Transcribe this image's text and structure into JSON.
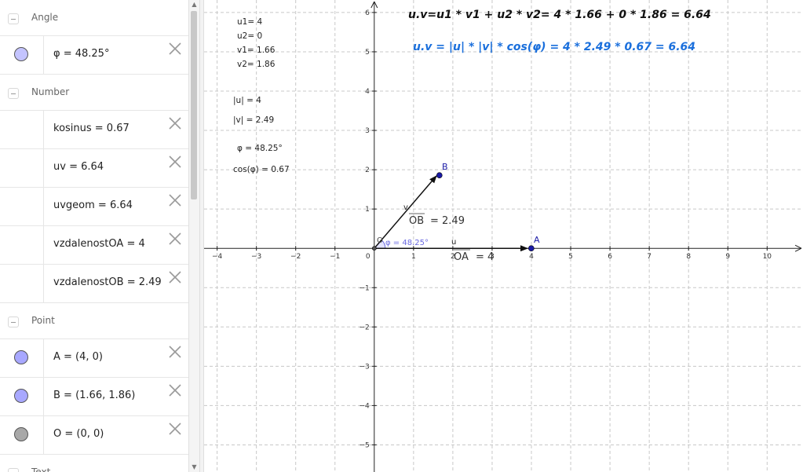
{
  "algebra": {
    "groups": [
      {
        "label": "Angle",
        "items": [
          {
            "text": "φ = 48.25°",
            "marker": "#c4c4ff"
          }
        ]
      },
      {
        "label": "Number",
        "items": [
          {
            "text": "kosinus = 0.67",
            "marker": ""
          },
          {
            "text": "uv = 6.64",
            "marker": ""
          },
          {
            "text": "uvgeom = 6.64",
            "marker": ""
          },
          {
            "text": "vzdalenostOA = 4",
            "marker": ""
          },
          {
            "text": "vzdalenostOB = 2.49",
            "marker": ""
          }
        ]
      },
      {
        "label": "Point",
        "items": [
          {
            "text": "A = (4, 0)",
            "marker": "#a8a8ff"
          },
          {
            "text": "B = (1.66, 1.86)",
            "marker": "#a8a8ff"
          },
          {
            "text": "O = (0, 0)",
            "marker": "#a8a8a8"
          }
        ]
      },
      {
        "label": "Text",
        "items": []
      }
    ]
  },
  "graphics": {
    "x_ticks": [
      "−4",
      "−3",
      "−2",
      "−1",
      "0",
      "1",
      "2",
      "3",
      "4",
      "5",
      "6",
      "7",
      "8",
      "9",
      "10"
    ],
    "y_ticks": [
      "6",
      "5",
      "4",
      "3",
      "2",
      "1",
      "−1",
      "−2",
      "−3",
      "−4",
      "−5"
    ],
    "texts": {
      "u1": "u1= 4",
      "u2": "u2= 0",
      "v1": "v1= 1.66",
      "v2": "v2= 1.86",
      "abs_u": "|u| = 4",
      "abs_v": "|v| = 2.49",
      "phi": "φ = 48.25°",
      "cos": "cos(φ) = 0.67",
      "formula1": "u.v=u1 * v1 + u2 * v2= 4 * 1.66 + 0 * 1.86 = 6.64",
      "formula2": "u.v = |u| * |v| * cos(φ) = 4 * 2.49 *  0.67 = 6.64"
    },
    "points": {
      "A": "A",
      "B": "B",
      "O": "O"
    },
    "vectors": {
      "u": "u",
      "v": "v"
    },
    "angle_label": "φ = 48.25°",
    "segment_labels": {
      "OB_name": "OB",
      "OB_value": "= 2.49",
      "OA_name": "OA",
      "OA_value": "= 4"
    },
    "colors": {
      "point": "#1a1aa6",
      "point_fill": "#2a2ad0",
      "angle": "#6a6ae0",
      "formula2": "#1a6fdc",
      "grid": "#c8c8c8"
    }
  }
}
